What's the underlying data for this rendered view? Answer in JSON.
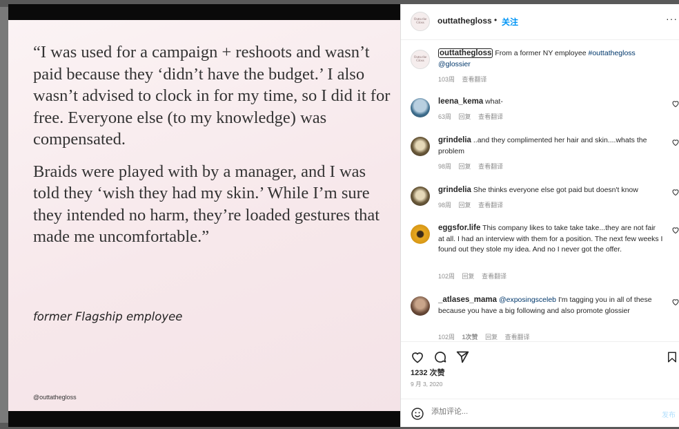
{
  "post": {
    "quote_paragraphs": [
      "“I was used for a campaign + reshoots and wasn’t paid because they ‘didn’t have the budget.’ I also wasn’t advised to clock in for my time, so I did it for free. Everyone else (to my knowledge) was compensated.",
      "Braids were played with by a manager, and I was told they ‘wish they had my skin.’ While I’m sure they intended no harm, they’re loaded gestures that made me uncomfortable.”"
    ],
    "attribution": "former Flagship employee",
    "watermark": "@outtathegloss"
  },
  "header": {
    "username": "outtathegloss",
    "dot": "•",
    "follow_label": "关注",
    "more_label": "···",
    "avatar_text": "Outta the Gloss"
  },
  "caption": {
    "username": "outtathegloss",
    "text_before": "From a former NY employee",
    "hashtag": "#outtathegloss",
    "mention": "@glossier",
    "time": "103周",
    "translate": "查看翻译"
  },
  "comments": [
    {
      "username": "leena_kema",
      "text": "what-",
      "time": "63周",
      "reply": "回复",
      "translate": "查看翻译",
      "avatar_color": "#5a8ab3"
    },
    {
      "username": "grindelia",
      "text": "..and they complimented her hair and skin....whats the problem",
      "time": "98周",
      "reply": "回复",
      "translate": "查看翻译",
      "avatar_color": "#8a7a5a"
    },
    {
      "username": "grindelia",
      "text": "She thinks everyone else got paid but doesn't know",
      "time": "98周",
      "reply": "回复",
      "translate": "查看翻译",
      "avatar_color": "#8a7a5a"
    },
    {
      "username": "eggsfor.life",
      "text": "This company likes to take take take...they are not fair at all. I had an interview with them for a position. The next few weeks I found out they stole my idea. And no I never got the offer.",
      "time": "102周",
      "reply": "回复",
      "translate": "查看翻译",
      "avatar_color": "#e0a320"
    },
    {
      "username": "_atlases_mama",
      "mention": "@exposingsceleb",
      "text": "I'm tagging you in all of these because you have a big following and also promote glossier",
      "time": "102周",
      "likes": "1次赞",
      "reply": "回复",
      "translate": "查看翻译",
      "avatar_color": "#7a5a48"
    }
  ],
  "actions": {
    "likes": "1232 次赞",
    "date": "9 月 3, 2020",
    "comment_placeholder": "添加评论...",
    "post_label": "发布"
  },
  "colors": {
    "accent": "#0095f6",
    "text": "#262626",
    "muted": "#8e8e8e"
  }
}
